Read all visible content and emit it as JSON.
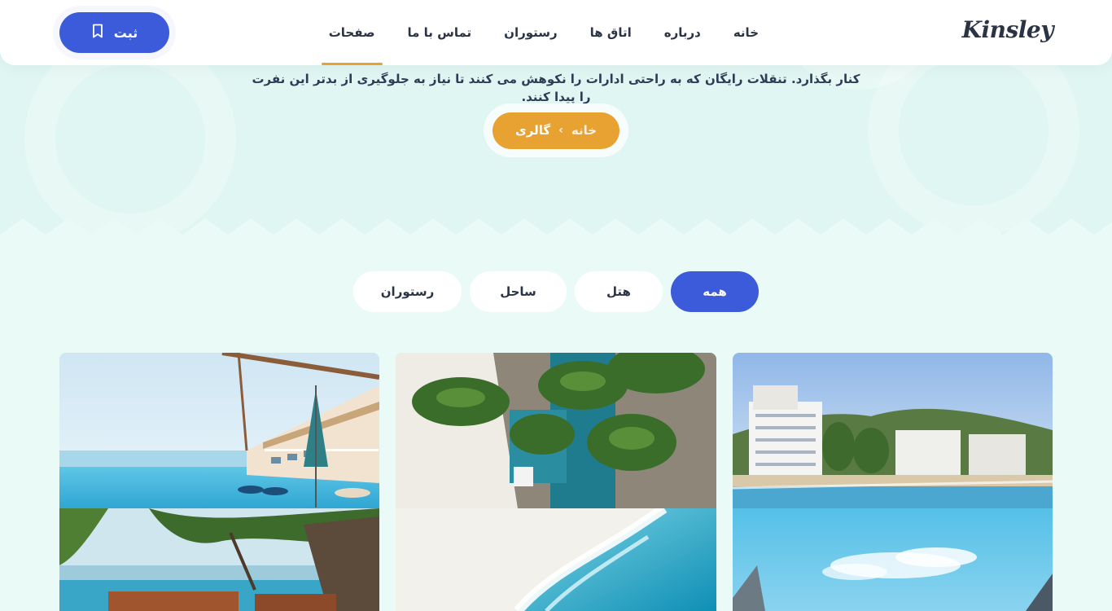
{
  "header": {
    "logo": "Kinsley",
    "nav": [
      {
        "label": "خانه"
      },
      {
        "label": "درباره"
      },
      {
        "label": "اتاق ها"
      },
      {
        "label": "رستوران"
      },
      {
        "label": "تماس با ما"
      },
      {
        "label": "صفحات"
      }
    ],
    "register_label": "ثبت"
  },
  "hero": {
    "text_line2": "کنار بگذارد. تنقلات رایگان که به راحتی ادارات را نکوهش می کنند تا نیاز به جلوگیری از بدتر این نفرت را پیدا کنند.",
    "breadcrumb": {
      "home": "خانه",
      "current": "گالری"
    }
  },
  "filters": [
    {
      "label": "همه",
      "active": true
    },
    {
      "label": "هتل",
      "active": false
    },
    {
      "label": "ساحل",
      "active": false
    },
    {
      "label": "رستوران",
      "active": false
    }
  ],
  "colors": {
    "accent_blue": "#3b5bdb",
    "accent_orange": "#e7a232",
    "background": "#e9faf7"
  },
  "gallery": {
    "images": [
      {
        "subject": "resort-infinity-pool-umbrella"
      },
      {
        "subject": "aerial-pool-palms"
      },
      {
        "subject": "beach-hotel-city"
      },
      {
        "subject": "tropical-pool-loungers"
      },
      {
        "subject": "aerial-ocean-waves"
      },
      {
        "subject": "blue-sky-clouds"
      }
    ]
  }
}
